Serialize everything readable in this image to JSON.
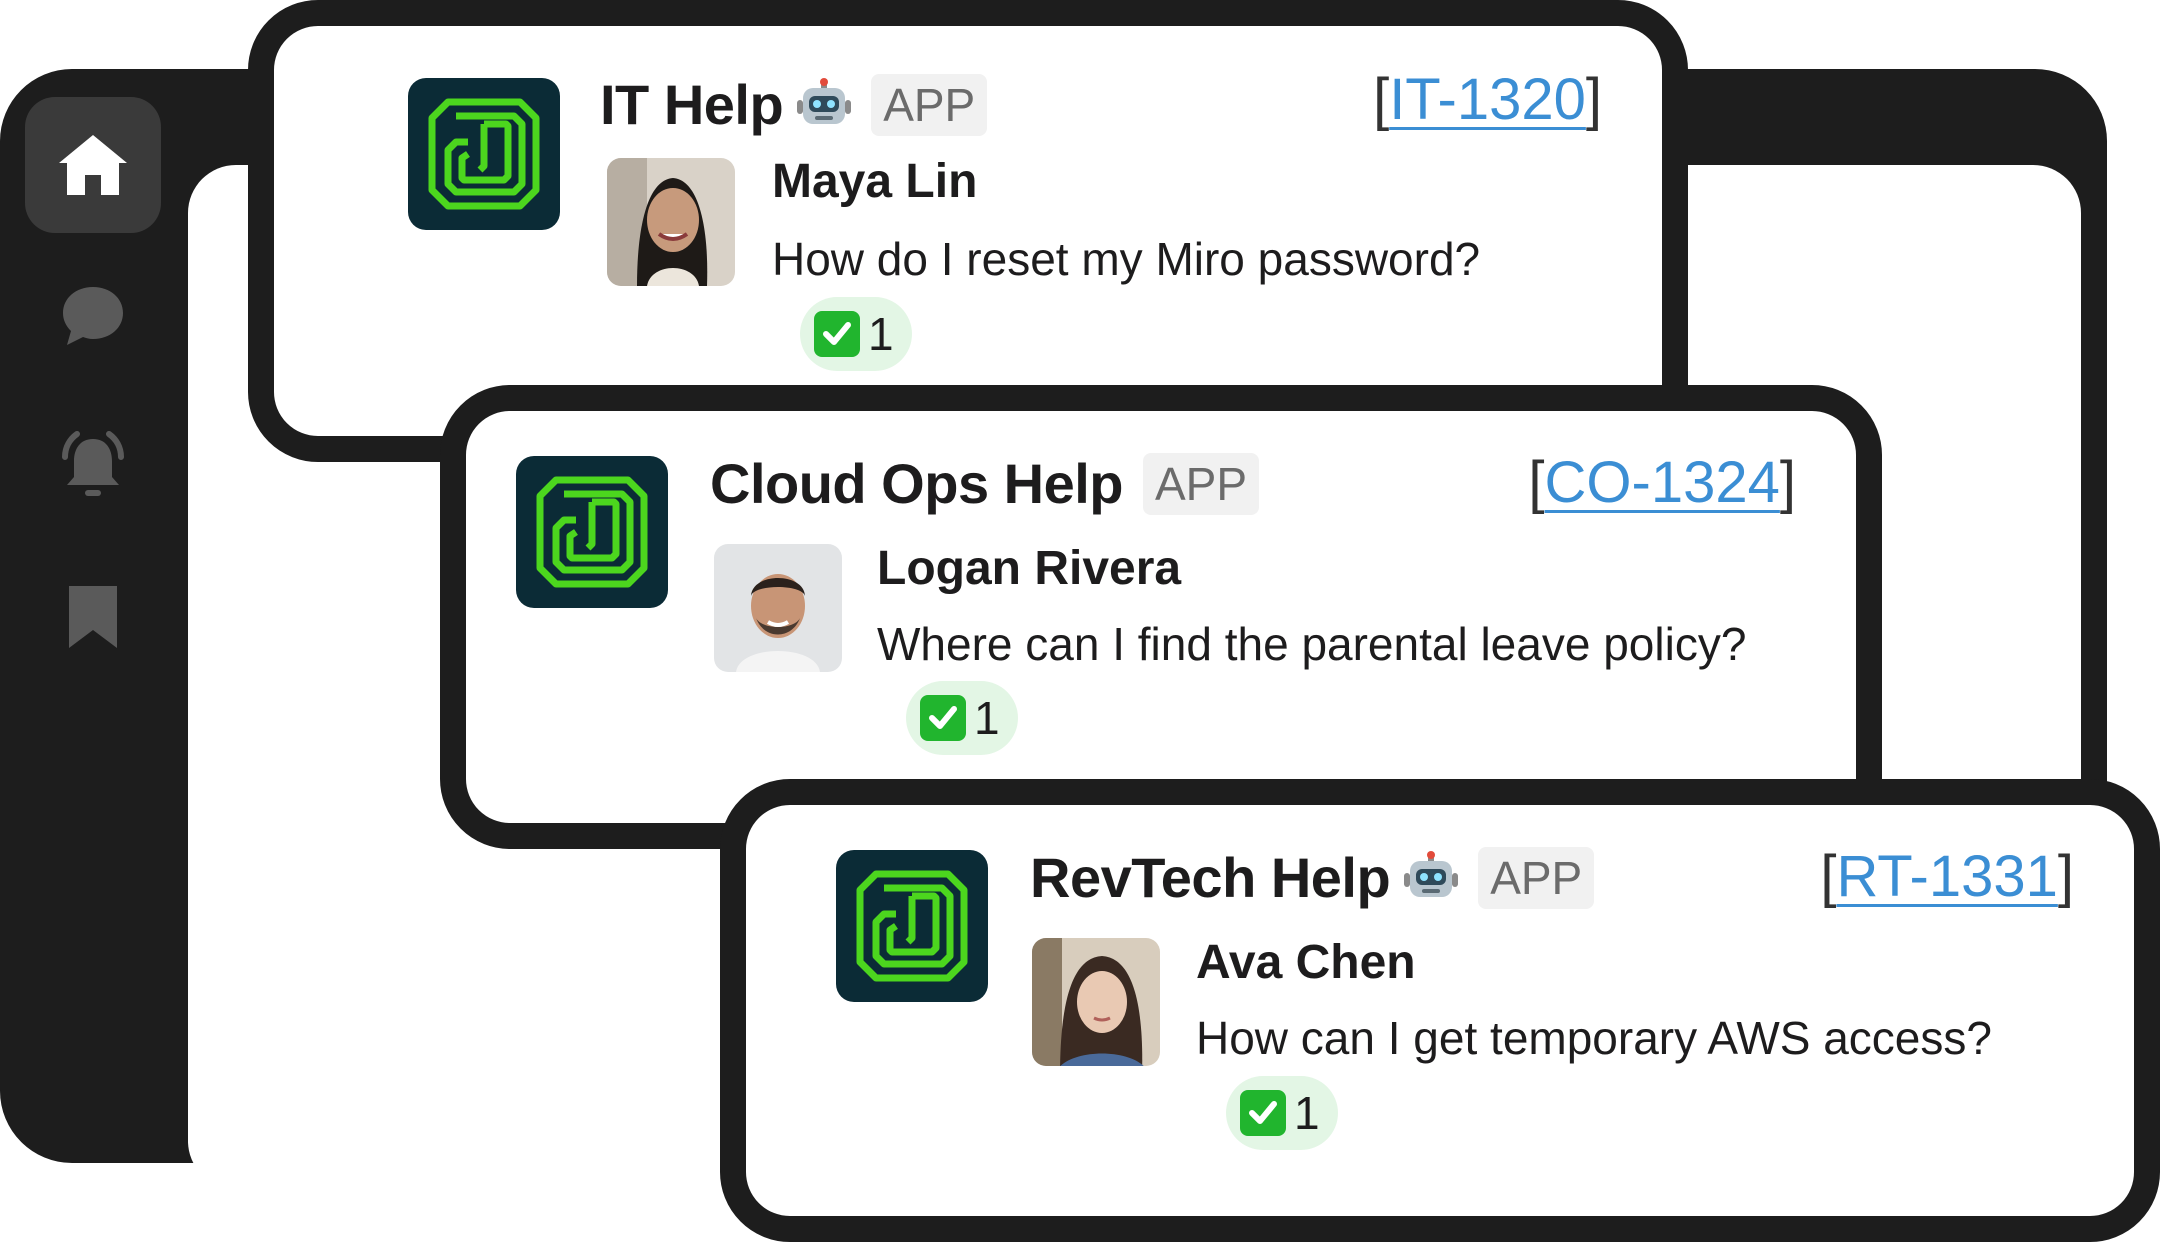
{
  "sidebar": {
    "items": [
      {
        "icon": "home-icon",
        "active": true
      },
      {
        "icon": "chat-bubble-icon",
        "active": false
      },
      {
        "icon": "bell-icon",
        "active": false
      },
      {
        "icon": "bookmark-icon",
        "active": false
      }
    ]
  },
  "colors": {
    "frame": "#1d1d1d",
    "logo_bg": "#0b2b36",
    "logo_green": "#4cd61e",
    "link": "#3b8ed4",
    "reaction_bg": "#e3f6e5",
    "check": "#21b52e"
  },
  "messages": [
    {
      "app_name": "IT Help",
      "has_robot": true,
      "badge": "APP",
      "ticket_open": "[",
      "ticket_id": "IT-1320",
      "ticket_close": "]",
      "user": "Maya Lin",
      "text": "How do I reset my Miro password?",
      "reaction_count": "1"
    },
    {
      "app_name": "Cloud Ops Help",
      "has_robot": false,
      "badge": "APP",
      "ticket_open": "[",
      "ticket_id": "CO-1324",
      "ticket_close": "]",
      "user": "Logan Rivera",
      "text": "Where can I find the parental leave policy?",
      "reaction_count": "1"
    },
    {
      "app_name": "RevTech Help",
      "has_robot": true,
      "badge": "APP",
      "ticket_open": "[",
      "ticket_id": "RT-1331",
      "ticket_close": "]",
      "user": "Ava Chen",
      "text": "How can I get temporary AWS access?",
      "reaction_count": "1"
    }
  ]
}
